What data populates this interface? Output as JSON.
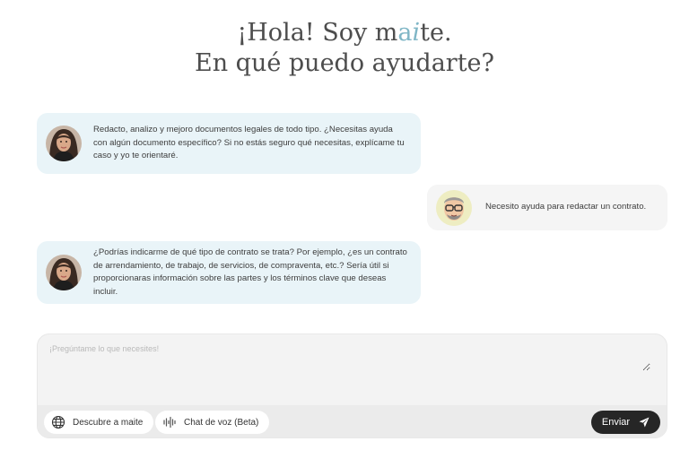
{
  "hero": {
    "line1_prefix": "¡Hola! Soy m",
    "line1_brand_a": "a",
    "line1_brand_i": "i",
    "line1_suffix": "te.",
    "line2": "En qué puedo ayudarte?"
  },
  "messages": [
    {
      "role": "assistant",
      "text": "Redacto, analizo y mejoro documentos legales de todo tipo. ¿Necesitas ayuda con algún documento específico? Si no estás seguro qué necesitas, explícame tu caso y yo te orientaré."
    },
    {
      "role": "user",
      "text": "Necesito ayuda para redactar un contrato."
    },
    {
      "role": "assistant",
      "text": "¿Podrías indicarme de qué tipo de contrato se trata? Por ejemplo, ¿es un contrato de arrendamiento, de trabajo, de servicios, de compraventa, etc.? Sería útil si proporcionaras información sobre las partes y los términos clave que deseas incluir."
    }
  ],
  "composer": {
    "placeholder": "¡Pregúntame lo que necesites!",
    "discover_label": "Descubre a maite",
    "voice_label": "Chat de voz (Beta)",
    "send_label": "Enviar"
  },
  "colors": {
    "brand": "#7fb6c6",
    "assistant_bubble": "#e9f4f8",
    "user_bubble": "#f5f5f5",
    "send_button": "#262626"
  },
  "icons": {
    "discover": "globe-icon",
    "voice": "audio-wave-icon",
    "send": "paper-plane-icon"
  }
}
